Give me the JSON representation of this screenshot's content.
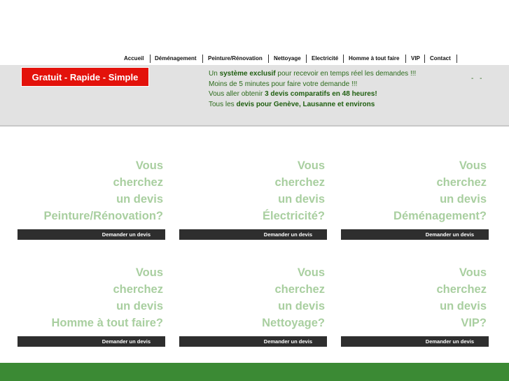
{
  "nav": {
    "items": [
      {
        "label": "Accueil"
      },
      {
        "label": "Déménagement"
      },
      {
        "label": "Peinture/Rénovation"
      },
      {
        "label": "Nettoyage"
      },
      {
        "label": "Electricité"
      },
      {
        "label": "Homme à tout faire"
      },
      {
        "label": "VIP"
      },
      {
        "label": "Contact"
      }
    ]
  },
  "banner": {
    "tagline": "Gratuit - Rapide - Simple",
    "promo": {
      "line1_pre": "Un ",
      "line1_bold": "système exclusif",
      "line1_post": " pour recevoir en temps réel les demandes !!!",
      "line2": "Moins de 5 minutes pour faire votre demande !!!",
      "line3_pre": "Vous aller obtenir ",
      "line3_bold": "3 devis comparatifs en 48 heures!",
      "line4_pre": "Tous les ",
      "line4_bold": "devis pour Genève, Lausanne et environs"
    },
    "dashes": "- -"
  },
  "cards": [
    {
      "l1": "Vous",
      "l2": "cherchez",
      "l3": "un devis",
      "l4": "Peinture/Rénovation?",
      "button": "Demander un devis"
    },
    {
      "l1": "Vous",
      "l2": "cherchez",
      "l3": "un devis",
      "l4": "Électricité?",
      "button": "Demander un devis"
    },
    {
      "l1": "Vous",
      "l2": "cherchez",
      "l3": "un devis",
      "l4": "Déménagement?",
      "button": "Demander un devis"
    },
    {
      "l1": "Vous",
      "l2": "cherchez",
      "l3": "un devis",
      "l4": "Homme à tout faire?",
      "button": "Demander un devis"
    },
    {
      "l1": "Vous",
      "l2": "cherchez",
      "l3": "un devis",
      "l4": "Nettoyage?",
      "button": "Demander un devis"
    },
    {
      "l1": "Vous",
      "l2": "cherchez",
      "l3": "un devis",
      "l4": "VIP?",
      "button": "Demander un devis"
    }
  ],
  "colors": {
    "tagline_bg": "#e3120b",
    "banner_bg": "#e2e2e2",
    "promo_text": "#2c6b1c",
    "card_text": "#a9cfa0",
    "button_bg": "#2e2e2e",
    "footer_bg": "#3b8a34"
  }
}
